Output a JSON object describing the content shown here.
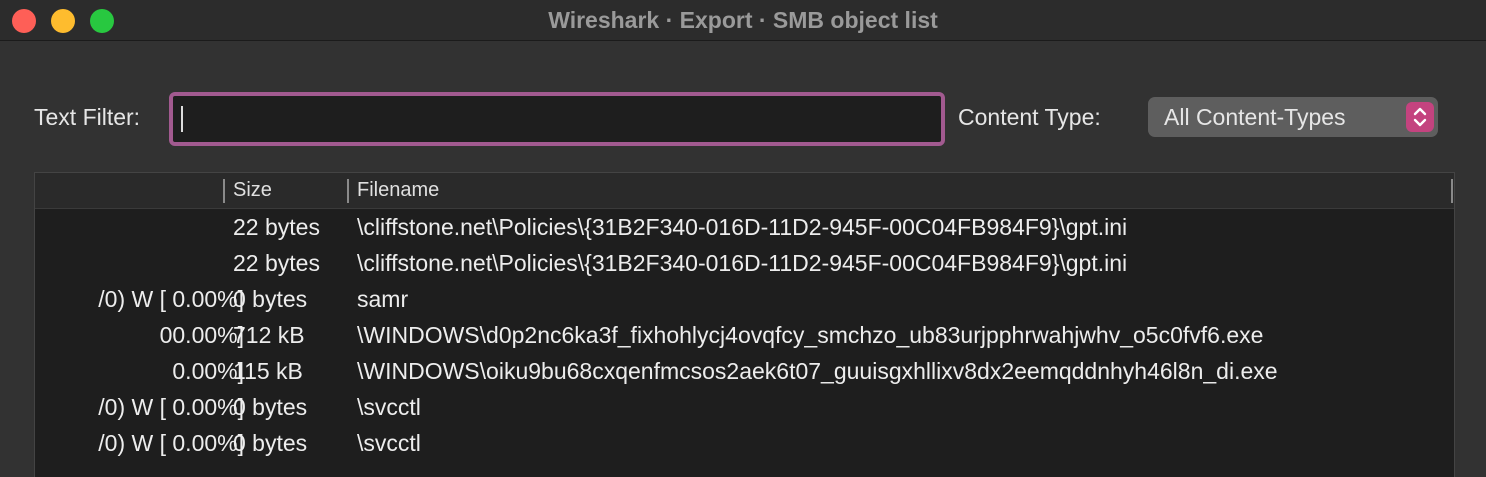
{
  "window": {
    "title": "Wireshark · Export · SMB object list"
  },
  "filter": {
    "text_filter_label": "Text Filter:",
    "text_filter_value": "",
    "content_type_label": "Content Type:",
    "content_type_selected": "All Content-Types"
  },
  "colors": {
    "focus_ring": "#a25a90",
    "stepper_accent": "#c4437f"
  },
  "table": {
    "columns": [
      "",
      "Size",
      "Filename"
    ],
    "rows": [
      {
        "packet": "",
        "size": "22 bytes",
        "filename": "\\cliffstone.net\\Policies\\{31B2F340-016D-11D2-945F-00C04FB984F9}\\gpt.ini"
      },
      {
        "packet": "",
        "size": "22 bytes",
        "filename": "\\cliffstone.net\\Policies\\{31B2F340-016D-11D2-945F-00C04FB984F9}\\gpt.ini"
      },
      {
        "packet": "/0) W [ 0.00%]",
        "size": "0 bytes",
        "filename": "samr"
      },
      {
        "packet": "00.00%]",
        "size": "712 kB",
        "filename": "\\WINDOWS\\d0p2nc6ka3f_fixhohlycj4ovqfcy_smchzo_ub83urjpphrwahjwhv_o5c0fvf6.exe"
      },
      {
        "packet": "0.00%]",
        "size": "115 kB",
        "filename": "\\WINDOWS\\oiku9bu68cxqenfmcsos2aek6t07_guuisgxhllixv8dx2eemqddnhyh46l8n_di.exe"
      },
      {
        "packet": "/0) W [ 0.00%]",
        "size": "0 bytes",
        "filename": "\\svcctl"
      },
      {
        "packet": "/0) W [ 0.00%]",
        "size": "0 bytes",
        "filename": "\\svcctl"
      }
    ]
  }
}
